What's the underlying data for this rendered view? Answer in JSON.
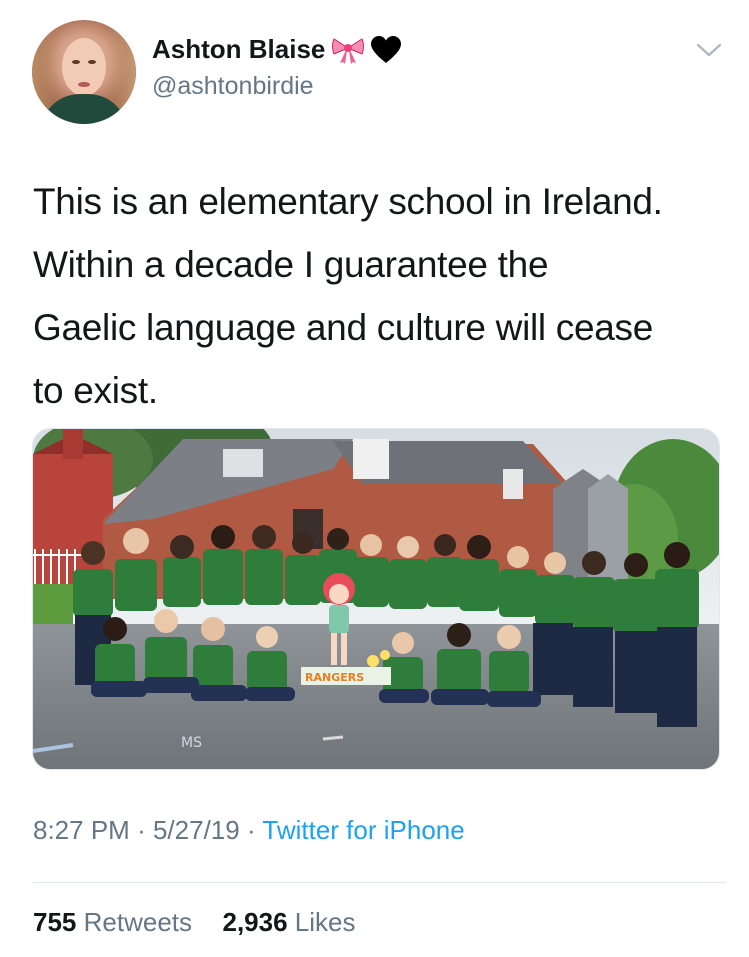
{
  "user": {
    "display_name": "Ashton Blaise",
    "handle": "@ashtonbirdie",
    "badges": [
      "ribbon-bow-emoji",
      "black-heart-emoji"
    ]
  },
  "tweet": {
    "text_lines": [
      "This is an elementary school in Ireland.",
      "Within a decade I guarantee the",
      "Gaelic language and culture will cease",
      "to exist."
    ],
    "media": {
      "type": "photo",
      "visible_text": [
        "RANGERS",
        "MS"
      ]
    },
    "time": "8:27 PM",
    "date": "5/27/19",
    "separator": "·",
    "source": "Twitter for iPhone"
  },
  "stats": {
    "retweets_count": "755",
    "retweets_label": "Retweets",
    "likes_count": "2,936",
    "likes_label": "Likes"
  },
  "colors": {
    "text": "#14171a",
    "secondary": "#657786",
    "link": "#1da1f2",
    "divider": "#e1e8ed"
  }
}
